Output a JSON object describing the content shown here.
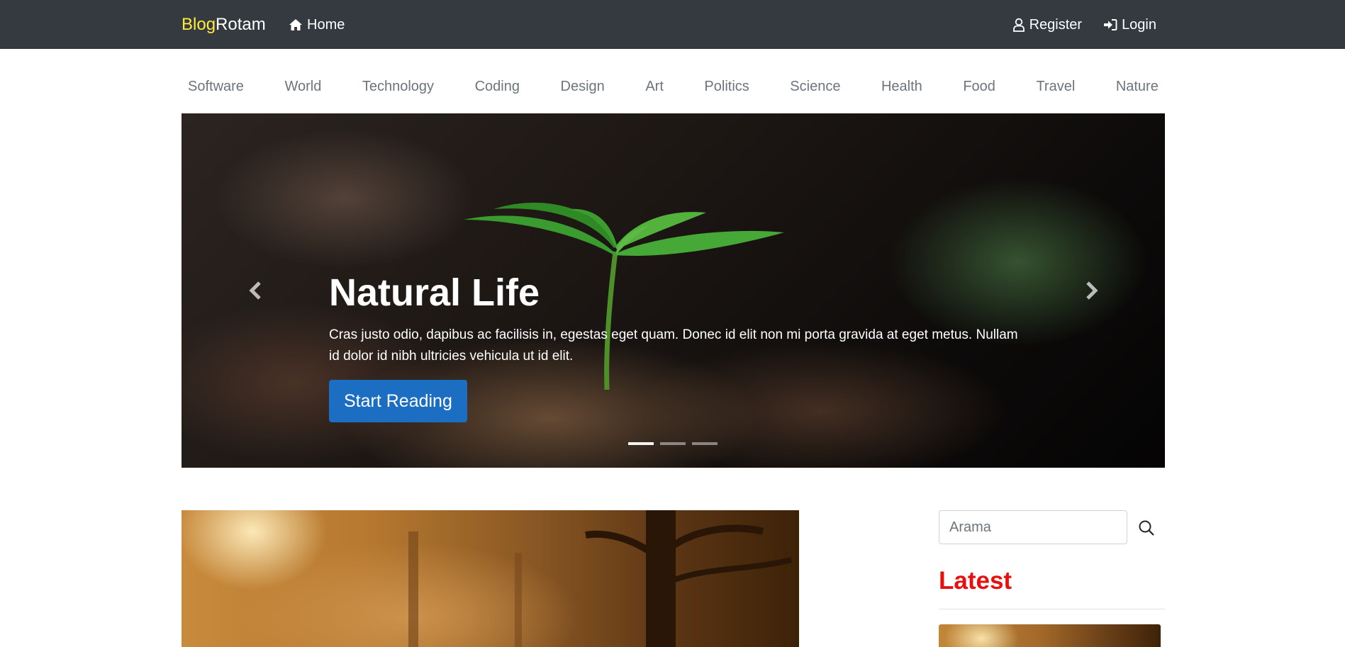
{
  "navbar": {
    "brand_part1": "Blog",
    "brand_part2": "Rotam",
    "home_label": "Home",
    "register_label": "Register",
    "login_label": "Login",
    "brand_accent_color": "#ffeb3b",
    "background_color": "#343a40"
  },
  "categories": [
    "Software",
    "World",
    "Technology",
    "Coding",
    "Design",
    "Art",
    "Politics",
    "Science",
    "Health",
    "Food",
    "Travel",
    "Nature"
  ],
  "hero": {
    "title": "Natural Life",
    "text": "Cras justo odio, dapibus ac facilisis in, egestas eget quam. Donec id elit non mi porta gravida at eget metus. Nullam id dolor id nibh ultricies vehicula ut id elit.",
    "button_label": "Start Reading",
    "button_color": "#1b6ec2",
    "active_slide": 1,
    "slide_count": 3
  },
  "sidebar": {
    "search_placeholder": "Arama",
    "latest_title": "Latest",
    "latest_color": "#e8100f"
  }
}
